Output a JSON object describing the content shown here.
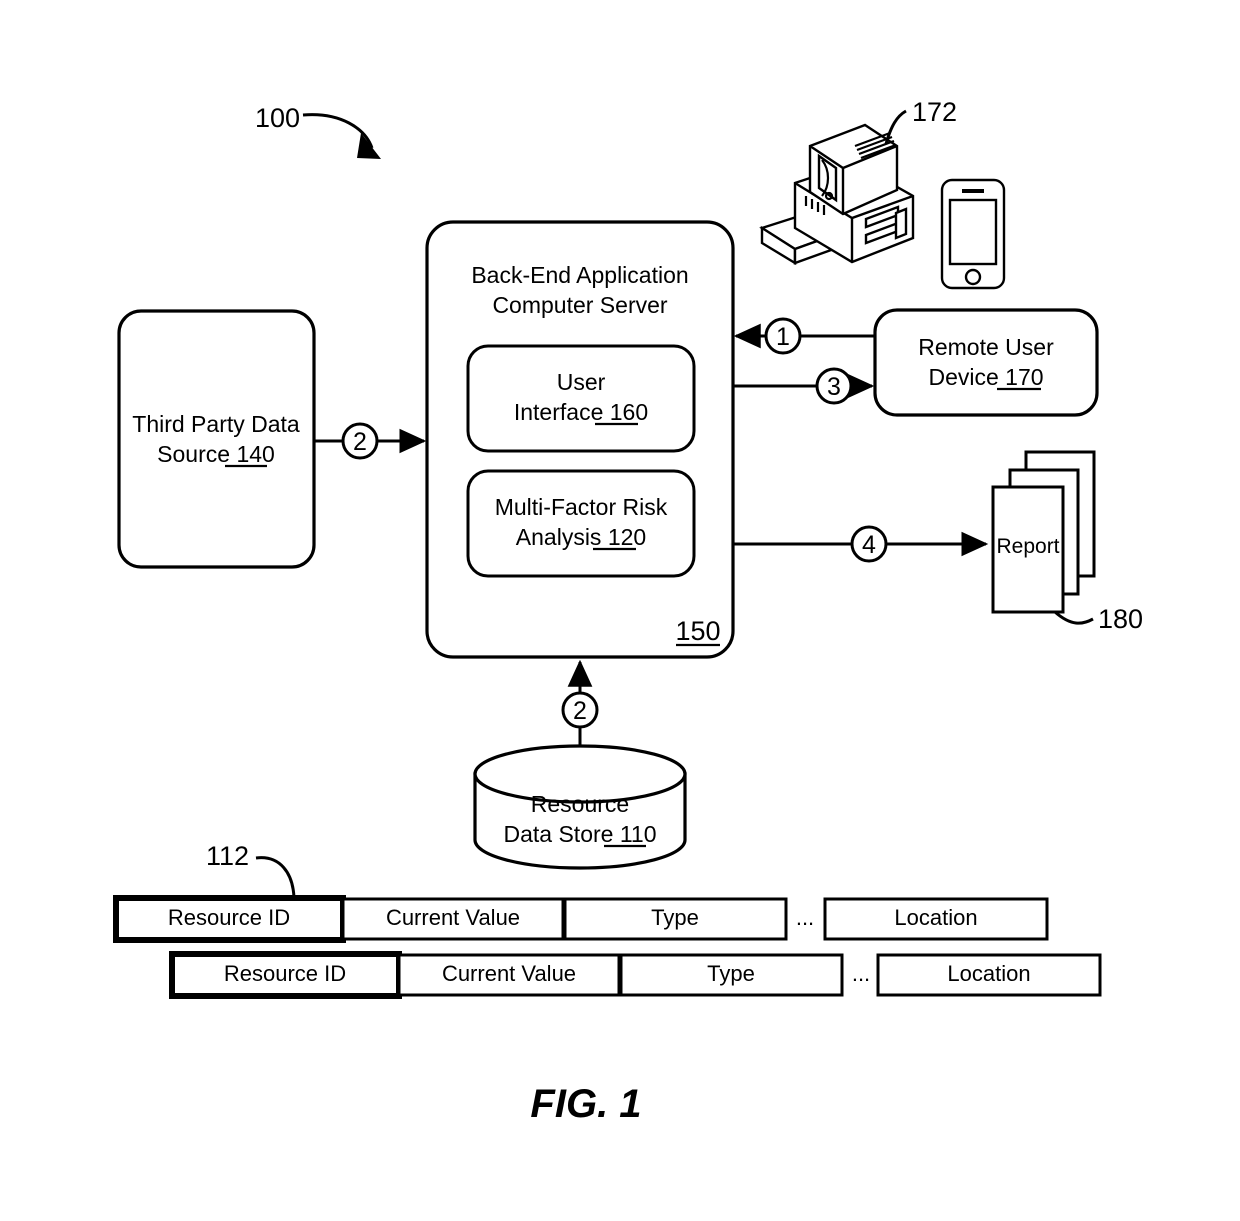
{
  "figure": {
    "caption": "FIG. 1",
    "system_ref": "100"
  },
  "nodes": {
    "third_party": {
      "name": "third-party-data-source",
      "line1": "Third Party Data",
      "line2_text": "Source ",
      "line2_ref": "140"
    },
    "server": {
      "name": "back-end-application-computer-server",
      "line1": "Back-End Application",
      "line2": "Computer Server",
      "ref": "150"
    },
    "user_interface": {
      "name": "user-interface-module",
      "line1": "User",
      "line2_text": "Interface ",
      "line2_ref": "160"
    },
    "risk_analysis": {
      "name": "multi-factor-risk-analysis-module",
      "line1": "Multi-Factor Risk",
      "line2_text": "Analysis ",
      "line2_ref": "120"
    },
    "remote_device": {
      "name": "remote-user-device",
      "line1": "Remote User",
      "line2_text": "Device ",
      "line2_ref": "170"
    },
    "report": {
      "name": "report-document-stack",
      "label": "Report",
      "ref": "180"
    },
    "data_store": {
      "name": "resource-data-store",
      "line1": "Resource",
      "line2_text": "Data Store ",
      "line2_ref": "110"
    },
    "workstation": {
      "name": "desktop-computer-icon",
      "ref": "172"
    },
    "smartphone": {
      "name": "smartphone-icon"
    }
  },
  "flow_markers": {
    "third_party_to_server": "2",
    "device_to_server": "1",
    "server_to_device": "3",
    "server_to_report": "4",
    "data_store_to_server": "2"
  },
  "record_ref": "112",
  "record_rows": [
    {
      "name": "resource-record-row-primary",
      "cells": [
        {
          "label": "Resource ID",
          "emphasis": true
        },
        {
          "label": "Current Value",
          "emphasis": false
        },
        {
          "label": "Type",
          "emphasis": false
        },
        {
          "label": "Location",
          "emphasis": false
        }
      ],
      "ellipsis": "..."
    },
    {
      "name": "resource-record-row-secondary",
      "cells": [
        {
          "label": "Resource ID",
          "emphasis": true
        },
        {
          "label": "Current Value",
          "emphasis": false
        },
        {
          "label": "Type",
          "emphasis": false
        },
        {
          "label": "Location",
          "emphasis": false
        }
      ],
      "ellipsis": "..."
    }
  ],
  "colors": {
    "ink": "#000000",
    "paper": "#ffffff"
  }
}
